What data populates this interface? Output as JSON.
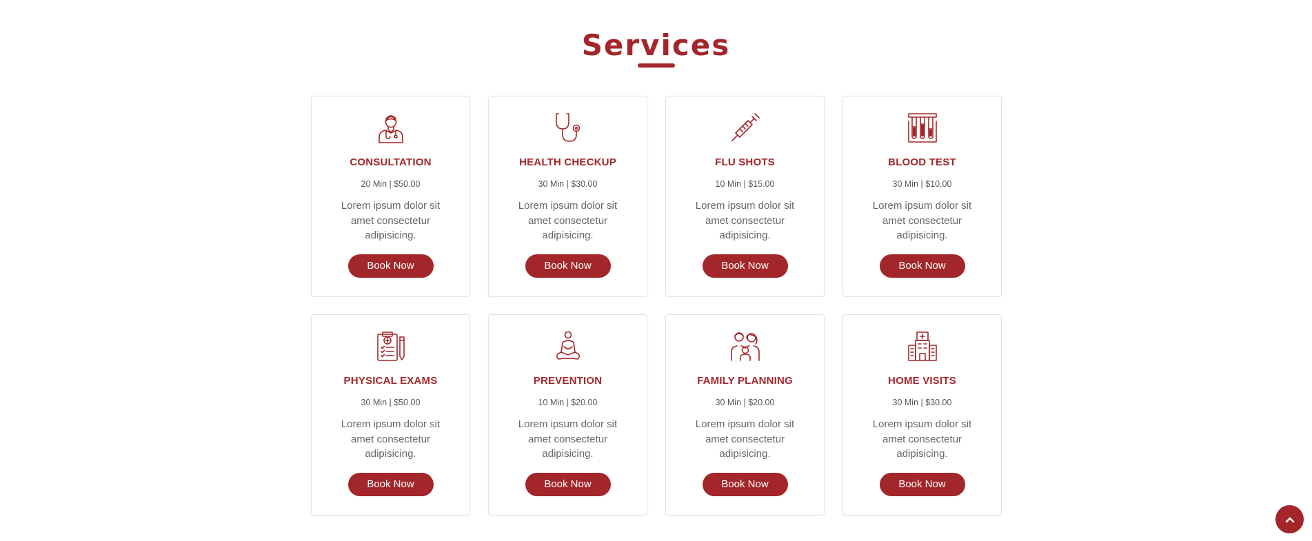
{
  "section": {
    "title": "Services"
  },
  "colors": {
    "accent": "#a3262a",
    "card_border": "#e3e3e3",
    "text_muted": "#666666"
  },
  "services": [
    {
      "icon": "doctor-icon",
      "title": "CONSULTATION",
      "meta": "20 Min | $50.00",
      "desc": "Lorem ipsum dolor sit amet consectetur adipisicing.",
      "button": "Book Now"
    },
    {
      "icon": "stethoscope-icon",
      "title": "HEALTH CHECKUP",
      "meta": "30 Min | $30.00",
      "desc": "Lorem ipsum dolor sit amet consectetur adipisicing.",
      "button": "Book Now"
    },
    {
      "icon": "syringe-icon",
      "title": "FLU SHOTS",
      "meta": "10 Min | $15.00",
      "desc": "Lorem ipsum dolor sit amet consectetur adipisicing.",
      "button": "Book Now"
    },
    {
      "icon": "blood-tubes-icon",
      "title": "BLOOD TEST",
      "meta": "30 Min | $10.00",
      "desc": "Lorem ipsum dolor sit amet consectetur adipisicing.",
      "button": "Book Now"
    },
    {
      "icon": "clipboard-icon",
      "title": "PHYSICAL EXAMS",
      "meta": "30 Min | $50.00",
      "desc": "Lorem ipsum dolor sit amet consectetur adipisicing.",
      "button": "Book Now"
    },
    {
      "icon": "meditation-icon",
      "title": "PREVENTION",
      "meta": "10 Min | $20.00",
      "desc": "Lorem ipsum dolor sit amet consectetur adipisicing.",
      "button": "Book Now"
    },
    {
      "icon": "family-icon",
      "title": "FAMILY PLANNING",
      "meta": "30 Min | $20.00",
      "desc": "Lorem ipsum dolor sit amet consectetur adipisicing.",
      "button": "Book Now"
    },
    {
      "icon": "hospital-icon",
      "title": "HOME VISITS",
      "meta": "30 Min | $30.00",
      "desc": "Lorem ipsum dolor sit amet consectetur adipisicing.",
      "button": "Book Now"
    }
  ],
  "scroll_top": {
    "icon": "chevron-up-icon"
  }
}
